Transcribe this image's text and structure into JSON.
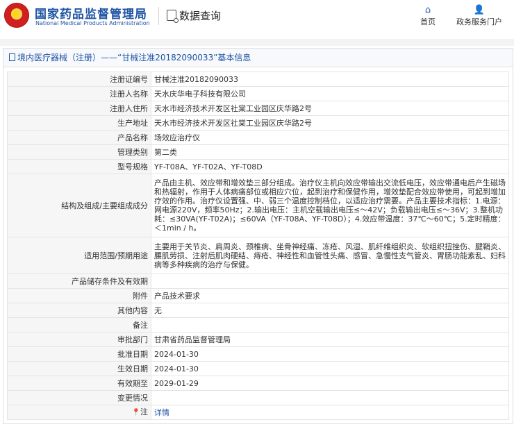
{
  "header": {
    "brand_cn": "国家药品监督管理局",
    "brand_en": "National Medical Products Administration",
    "query_label": "数据查询",
    "nav": {
      "home": "首页",
      "service": "政务服务门户"
    }
  },
  "panel": {
    "title": "境内医疗器械（注册）——“甘械注准20182090033”基本信息"
  },
  "record": {
    "reg_no_label": "注册证编号",
    "reg_no": "甘械注准20182090033",
    "registrant_label": "注册人名称",
    "registrant": "天水庆华电子科技有限公司",
    "address_label": "注册人住所",
    "address": "天水市经济技术开发区社棠工业园区庆华路2号",
    "mfg_address_label": "生产地址",
    "mfg_address": "天水市经济技术开发区社棠工业园区庆华路2号",
    "product_label": "产品名称",
    "product": "场效应治疗仪",
    "category_label": "管理类别",
    "category": "第二类",
    "model_label": "型号规格",
    "model": "YF-T08A、YF-T02A、YF-T08D",
    "structure_label": "结构及组成/主要组成成分",
    "structure": "产品由主机、效应带和增效垫三部分组成。治疗仪主机向效应带输出交流低电压，效应带通电后产生磁场和热辐射，作用于人体病痛部位或相应穴位，起到治疗和保健作用，增效垫配合效应带使用，可起到增加疗效的作用。治疗仪设置强、中、弱三个温度控制档位，以适应治疗需要。产品主要技术指标：1.电源：网电源220V，频率50Hz；2.输出电压：主机空载输出电压≤～42V；负载输出电压≤～36V；3.整机功耗：≤30VA(YF-T02A)；≤60VA（YF-T08A、YF-T08D）；4.效应带温度：37℃～60℃；5.定时精度：＜1min / h。",
    "scope_label": "适用范围/预期用途",
    "scope": "主要用于关节炎、肩周炎、颈椎病、坐骨神经痛、冻疮、风湿、肌纤维组织炎、软组织扭挫伤、腱鞘炎、腰肌劳损、注射后肌肉硬结、痔疮、神经性和血管性头痛、感冒、急慢性支气管炎、胃肠功能紊乱、妇科病等多种疾病的治疗与保健。",
    "storage_label": "产品储存条件及有效期",
    "storage": "",
    "attachment_label": "附件",
    "attachment": "产品技术要求",
    "other_label": "其他内容",
    "other": "无",
    "remark_label": "备注",
    "remark": "",
    "approver_label": "审批部门",
    "approver": "甘肃省药品监督管理局",
    "approval_date_label": "批准日期",
    "approval_date": "2024-01-30",
    "effective_date_label": "生效日期",
    "effective_date": "2024-01-30",
    "expiry_label": "有效期至",
    "expiry": "2029-01-29",
    "change_label": "变更情况",
    "change": "",
    "note_label": "注",
    "note_link": "详情"
  }
}
